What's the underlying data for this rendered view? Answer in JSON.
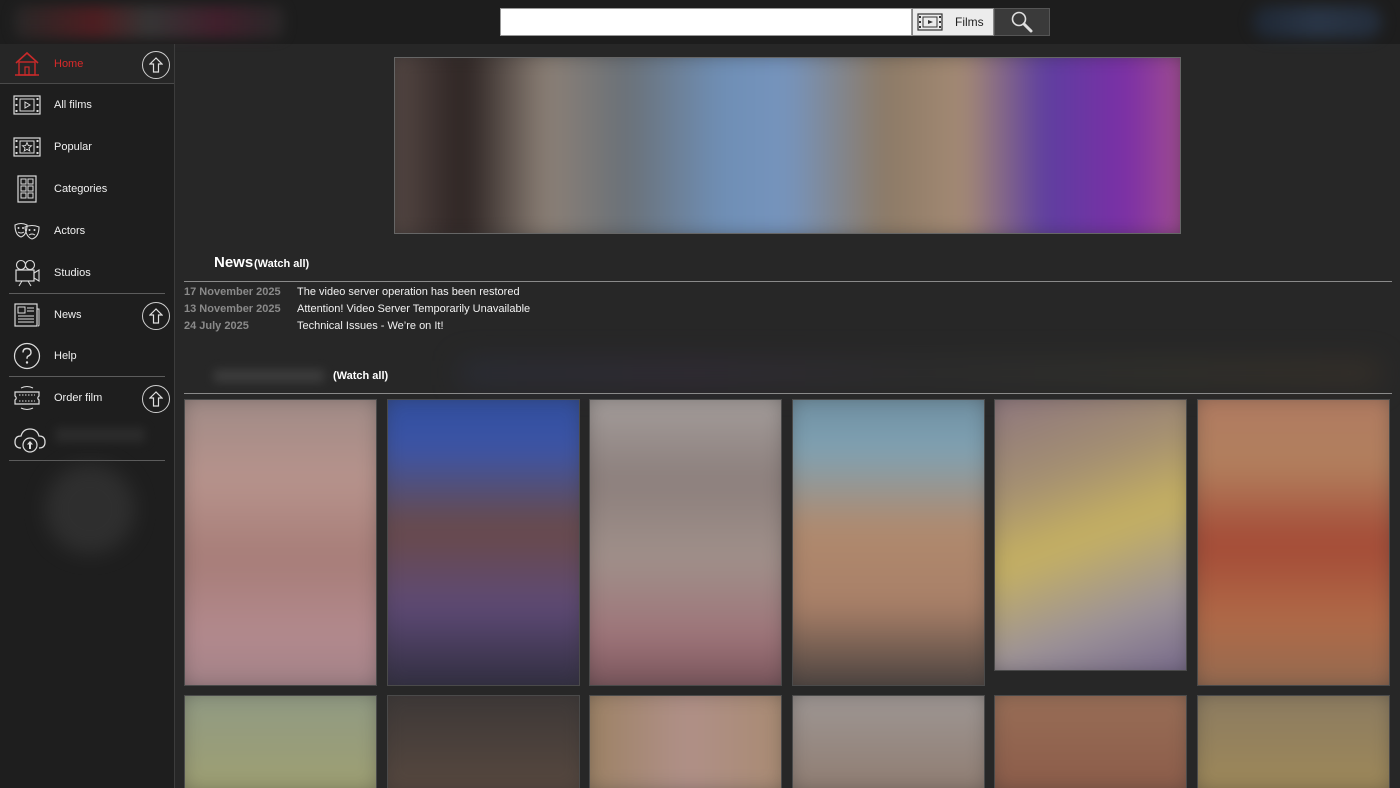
{
  "search": {
    "placeholder": "",
    "value": "",
    "type_label": "Films"
  },
  "sidebar": {
    "items": [
      {
        "label": "Home",
        "icon": "home-icon",
        "active": true
      },
      {
        "label": "All films",
        "icon": "film-icon"
      },
      {
        "label": "Popular",
        "icon": "star-film-icon"
      },
      {
        "label": "Categories",
        "icon": "categories-icon"
      },
      {
        "label": "Actors",
        "icon": "theater-masks-icon"
      },
      {
        "label": "Studios",
        "icon": "camera-icon"
      },
      {
        "label": "News",
        "icon": "newspaper-icon"
      },
      {
        "label": "Help",
        "icon": "help-icon"
      },
      {
        "label": "Order film",
        "icon": "ticket-icon"
      }
    ]
  },
  "news": {
    "title": "News",
    "watch_all": "(Watch all)",
    "items": [
      {
        "date": "17 November 2025",
        "text": "The video server operation has been restored"
      },
      {
        "date": "13 November 2025",
        "text": "Attention! Video Server Temporarily Unavailable"
      },
      {
        "date": "24 July 2025",
        "text": "Technical Issues - We’re on It!"
      }
    ]
  },
  "films_section": {
    "watch_all": "(Watch all)"
  },
  "colors": {
    "accent": "#d92a2a",
    "background": "#272727",
    "sidebar": "#1e1e1e",
    "topbar": "#1d1d1d"
  }
}
